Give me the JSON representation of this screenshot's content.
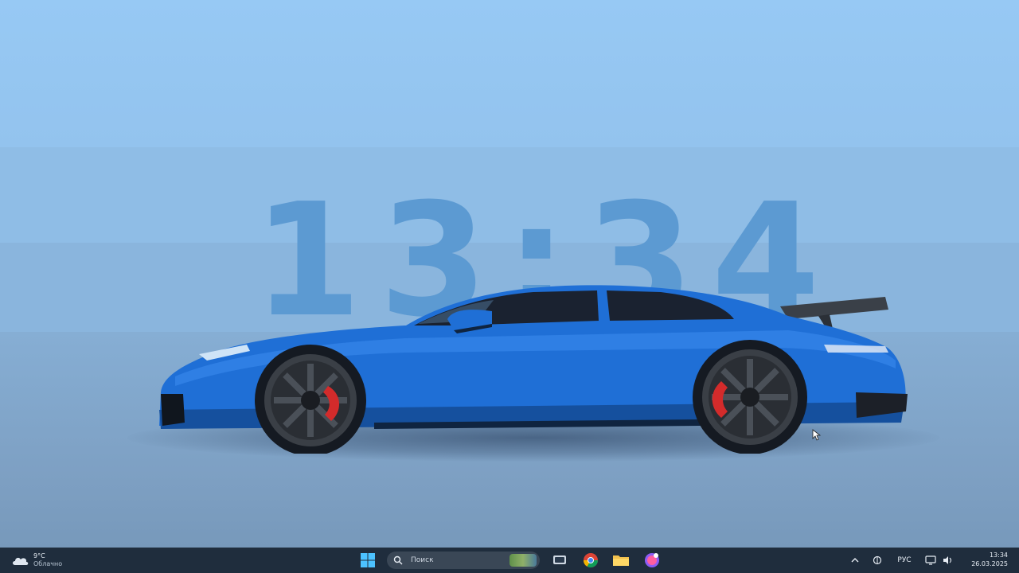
{
  "desktop": {
    "clock_overlay": "13:34",
    "wallpaper_colors": {
      "sky": "#97c9f4",
      "floor": "#7d9fc2",
      "car_body": "#1f6fd6",
      "calipers": "#d32b2b"
    }
  },
  "taskbar": {
    "weather": {
      "temperature": "9°C",
      "condition": "Облачно",
      "icon": "cloud-icon"
    },
    "start_icon": "windows-logo-icon",
    "search": {
      "placeholder": "Поиск",
      "icon": "search-icon"
    },
    "pinned_apps": [
      {
        "name": "Task View",
        "icon": "task-view-icon"
      },
      {
        "name": "Chrome",
        "icon": "chrome-icon"
      },
      {
        "name": "File Explorer",
        "icon": "folder-icon"
      },
      {
        "name": "Messenger",
        "icon": "messenger-icon"
      }
    ],
    "tray": {
      "overflow_icon": "chevron-up-icon",
      "network_icon": "network-icon",
      "language": "РУС",
      "display_icon": "display-icon",
      "volume_icon": "volume-icon",
      "time": "13:34",
      "date": "26.03.2025"
    }
  }
}
